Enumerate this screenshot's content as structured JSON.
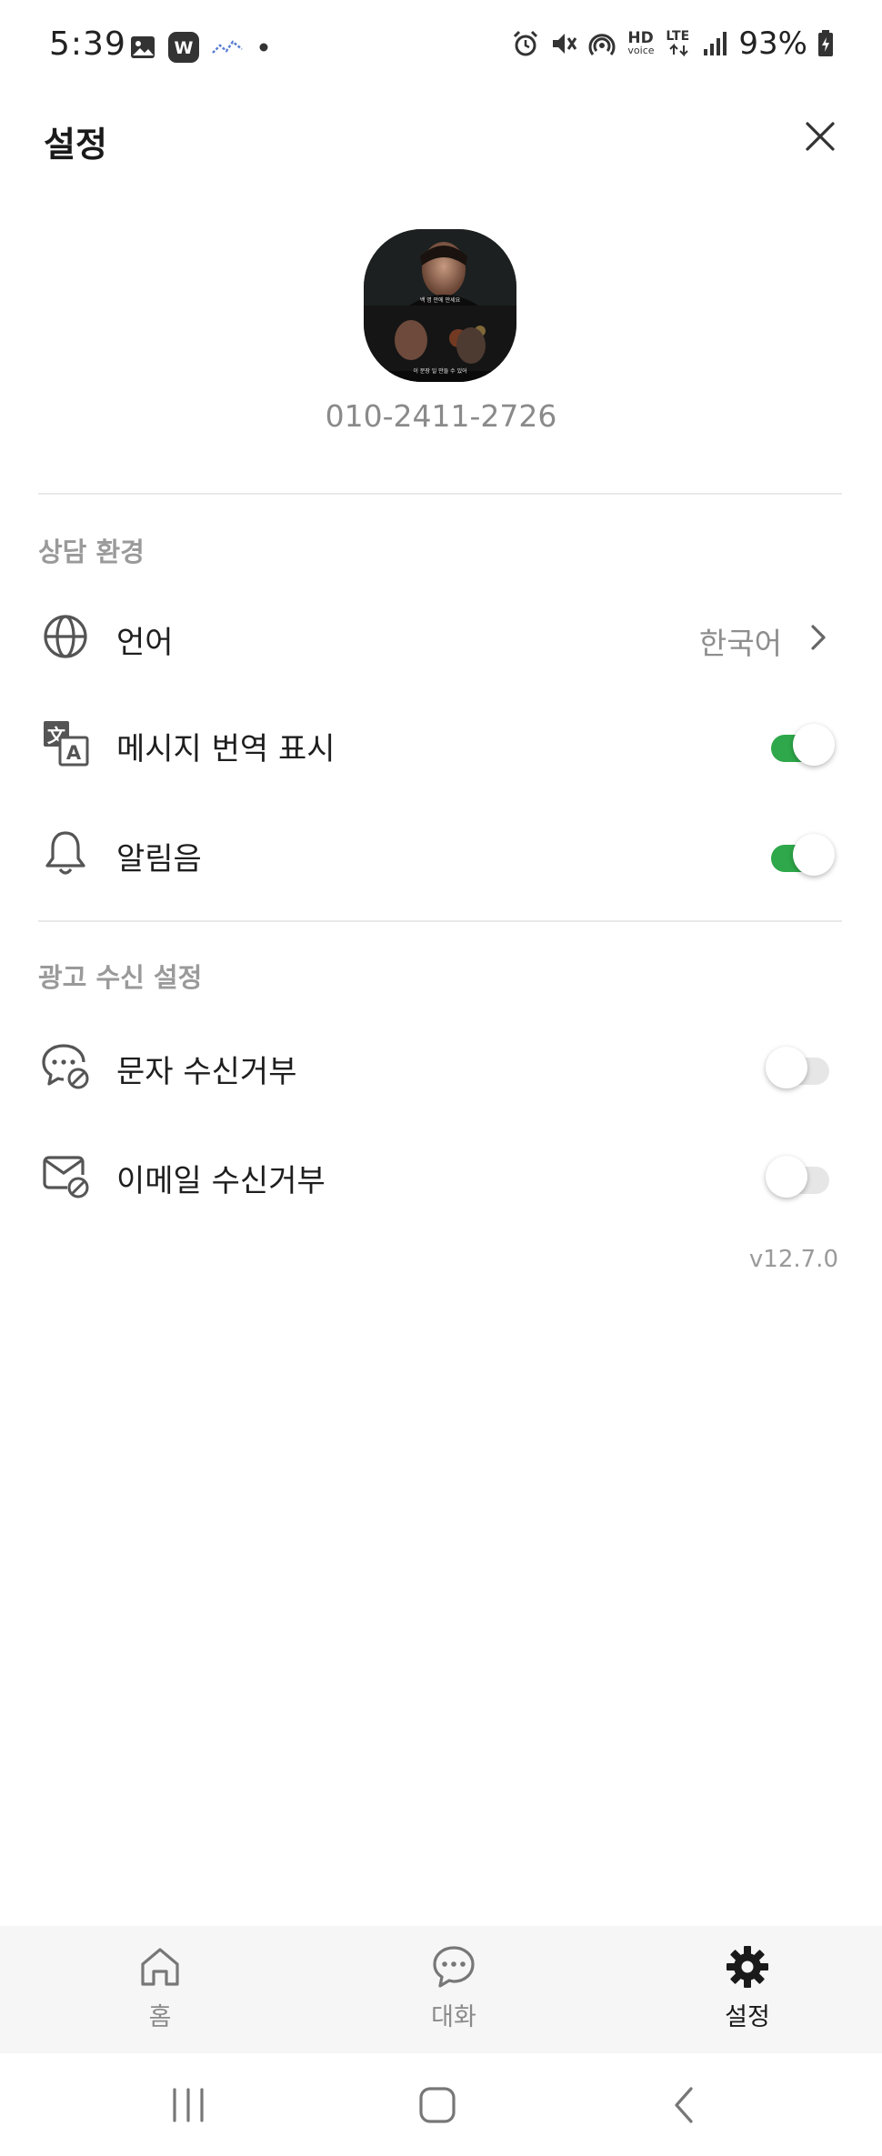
{
  "status_bar": {
    "time": "5:39",
    "battery": "93%",
    "left_icons": [
      "image-icon",
      "w-app-icon",
      "activity-icon",
      "dot-icon"
    ],
    "right_icons": [
      "alarm-icon",
      "mute-icon",
      "hotspot-icon",
      "hd-voice-icon",
      "lte-icon",
      "signal-icon",
      "battery-charging-icon"
    ],
    "hd_label": "HD",
    "voice_label": "voice",
    "lte_label": "LTE"
  },
  "header": {
    "title": "설정",
    "close_icon": "close-icon"
  },
  "profile": {
    "phone": "010-2411-2726",
    "avatar_caption_top": "백 명 만에 만세요",
    "avatar_caption_bottom": "이 문장 일 만들 수 있어"
  },
  "sections": {
    "consult": {
      "title": "상담 환경",
      "language": {
        "label": "언어",
        "value": "한국어",
        "icon": "globe-icon"
      },
      "translate": {
        "label": "메시지 번역 표시",
        "on": true,
        "icon": "translate-icon"
      },
      "sound": {
        "label": "알림음",
        "on": true,
        "icon": "bell-icon"
      }
    },
    "ads": {
      "title": "광고 수신 설정",
      "sms": {
        "label": "문자 수신거부",
        "on": false,
        "icon": "chat-blocked-icon"
      },
      "email": {
        "label": "이메일 수신거부",
        "on": false,
        "icon": "mail-blocked-icon"
      }
    }
  },
  "version": "v12.7.0",
  "bottom_nav": {
    "home": {
      "label": "홈",
      "icon": "home-icon"
    },
    "chat": {
      "label": "대화",
      "icon": "chat-icon"
    },
    "settings": {
      "label": "설정",
      "icon": "gear-icon",
      "active": true
    }
  },
  "colors": {
    "accent_green": "#2ea84a",
    "text_primary": "#1e1e1e",
    "text_secondary": "#8e8e8e",
    "nav_background": "#f6f6f6"
  }
}
